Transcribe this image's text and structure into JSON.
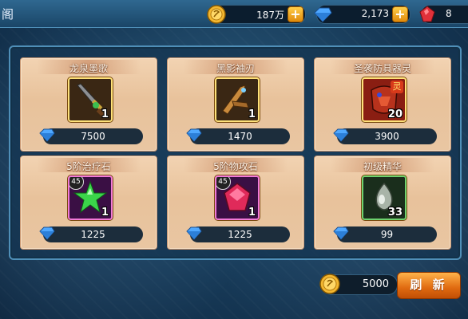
{
  "header": {
    "title": "阁",
    "gold": "187万",
    "diamonds": "2,173",
    "hearts": "8"
  },
  "shop_items": [
    {
      "name": "龙泉墨歌",
      "count": "1",
      "price": "7500",
      "level": "",
      "icon": "sword-icon"
    },
    {
      "name": "黑影袖刃",
      "count": "1",
      "price": "1470",
      "level": "",
      "icon": "blade-icon"
    },
    {
      "name": "圣袭防具器灵",
      "count": "20",
      "price": "3900",
      "level": "",
      "badge": "灵",
      "icon": "armor-spirit-icon"
    },
    {
      "name": "5阶治疗石",
      "count": "1",
      "price": "1225",
      "level": "45",
      "icon": "green-star-gem-icon"
    },
    {
      "name": "5阶物攻石",
      "count": "1",
      "price": "1225",
      "level": "45",
      "icon": "red-gem-icon"
    },
    {
      "name": "初级精华",
      "count": "33",
      "price": "99",
      "level": "",
      "icon": "essence-icon"
    }
  ],
  "footer": {
    "refresh_cost": "5000",
    "refresh_label": "刷 新"
  }
}
